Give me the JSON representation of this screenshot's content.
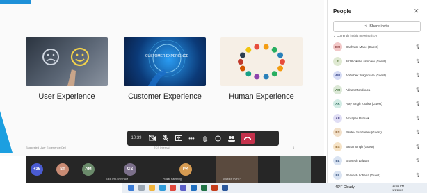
{
  "slide": {
    "captions": [
      "User Experience",
      "Customer Experience",
      "Human Experience"
    ],
    "card2_text": "CUSTOMER EXPERIENCE",
    "footer_left": "Suggested User Experience Cell",
    "footer_mid": "TCS Internal",
    "footer_right": "6"
  },
  "toolbar": {
    "time": "10:39"
  },
  "strip": {
    "avatars": [
      {
        "initials": "+35",
        "color": "#4a5bd1"
      },
      {
        "initials": "ST",
        "color": "#c98b74"
      },
      {
        "initials": "AM",
        "color": "#6a8a6a"
      },
      {
        "initials": "GS",
        "color": "#7b6f8a"
      },
      {
        "initials": "PK",
        "color": "#d69b52"
      }
    ],
    "names": [
      "GEETHA SHIVRAM",
      "Prasad Kamthing",
      "SUDEEP PORTY"
    ]
  },
  "taskbar": {
    "weather": "40°F Cloudy",
    "time": "12:54 PM",
    "date": "1/1/2023"
  },
  "people": {
    "title": "People",
    "share_label": "Share invite",
    "section": "Currently in this meeting (47)",
    "members": [
      {
        "initials": "DM",
        "name": "Dashrath Mane (Guest)",
        "bg": "#f2c7c7",
        "fg": "#8a3a3a"
      },
      {
        "initials": "2",
        "name": "2018.diksha.ramnani (Guest)",
        "bg": "#dfe9d2",
        "fg": "#4b6b2a"
      },
      {
        "initials": "AW",
        "name": "Abhishek Waghmare (Guest)",
        "bg": "#d6dcf5",
        "fg": "#39478a"
      },
      {
        "initials": "AM",
        "name": "Adnan Mondonca",
        "bg": "#dbe8d6",
        "fg": "#3c6a36"
      },
      {
        "initials": "AK",
        "name": "Ajay Singh Khalsa (Guest)",
        "bg": "#d3ece5",
        "fg": "#2c6a5a"
      },
      {
        "initials": "AP",
        "name": "Amrapali Patnaik",
        "bg": "#e0def5",
        "fg": "#4f4a8a"
      },
      {
        "initials": "BS",
        "name": "Baldev Sundarani (Guest)",
        "bg": "#f2e0c9",
        "fg": "#8a5a2a"
      },
      {
        "initials": "BS",
        "name": "Barun Singh (Guest)",
        "bg": "#f6e3c6",
        "fg": "#8a5e1f"
      },
      {
        "initials": "BL",
        "name": "Bhavesh Lalwani",
        "bg": "#d9e3f2",
        "fg": "#3a5680"
      },
      {
        "initials": "BL",
        "name": "Bhavesh Lohana (Guest)",
        "bg": "#d9e3f2",
        "fg": "#3a5680"
      }
    ]
  }
}
